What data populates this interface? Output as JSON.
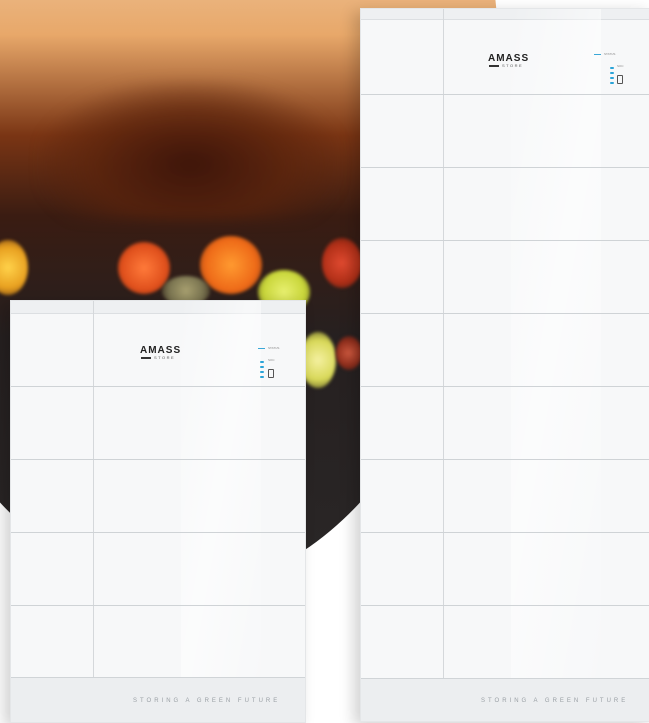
{
  "scene": {
    "description_colors": {
      "sky_top": "#f4e5d3",
      "sky_glow": "#e8a86a",
      "dark_ground": "#262020",
      "cabinet_white": "#f7f8f9",
      "led_blue": "#2aa4d8"
    }
  },
  "small_unit": {
    "brand": "AMASS",
    "brand_sub": "STORE",
    "status_label": "STATUS",
    "level_label": "SOC",
    "tagline": "STORING A GREEN FUTURE"
  },
  "large_unit": {
    "brand": "AMASS",
    "brand_sub": "STORE",
    "status_label": "STATUS",
    "level_label": "SOC",
    "tagline": "STORING A GREEN FUTURE"
  },
  "icons": {
    "battery": "battery-icon",
    "led": "status-led-icon"
  }
}
